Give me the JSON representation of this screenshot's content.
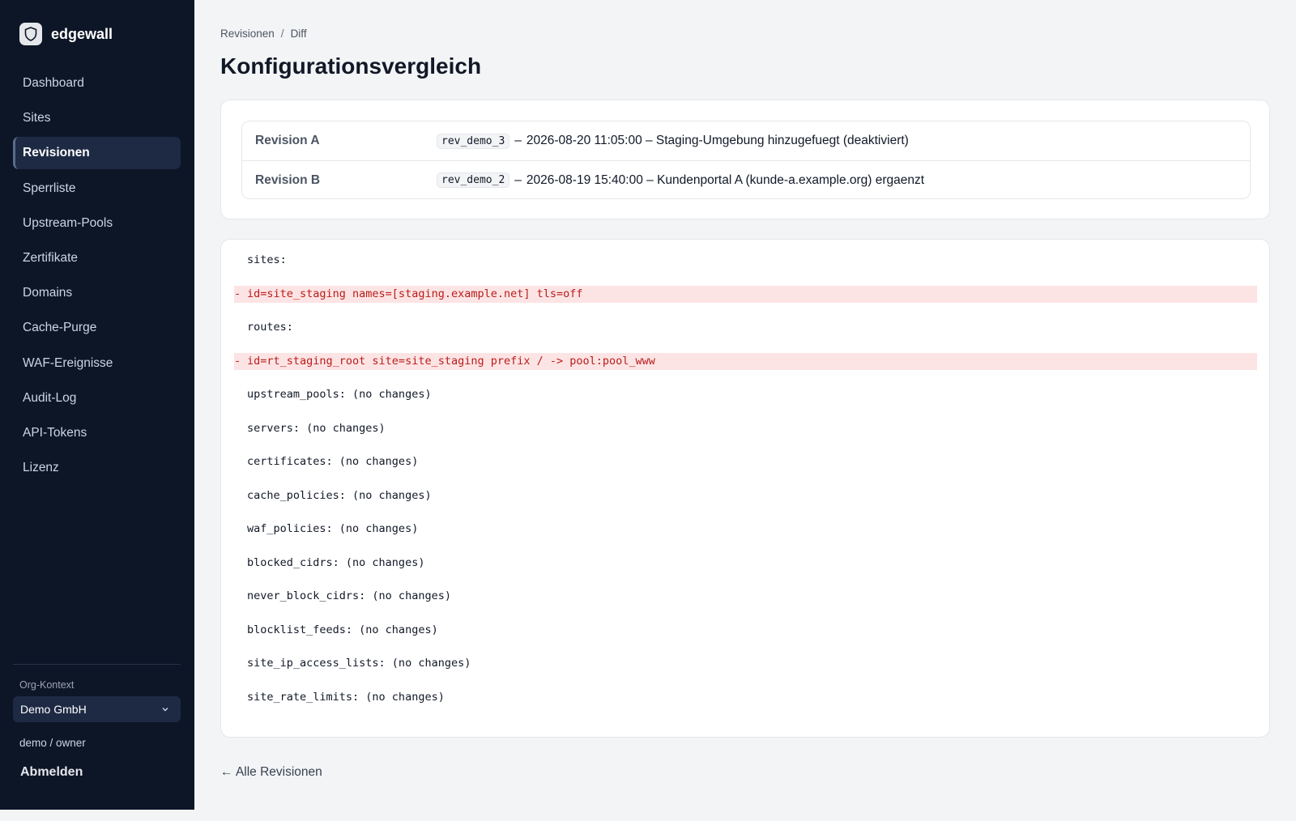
{
  "app": {
    "name": "edgewall",
    "logo_icon": "shield-icon"
  },
  "sidebar": {
    "items": [
      {
        "label": "Dashboard",
        "active": false
      },
      {
        "label": "Sites",
        "active": false
      },
      {
        "label": "Revisionen",
        "active": true
      },
      {
        "label": "Sperrliste",
        "active": false
      },
      {
        "label": "Upstream-Pools",
        "active": false
      },
      {
        "label": "Zertifikate",
        "active": false
      },
      {
        "label": "Domains",
        "active": false
      },
      {
        "label": "Cache-Purge",
        "active": false
      },
      {
        "label": "WAF-Ereignisse",
        "active": false
      },
      {
        "label": "Audit-Log",
        "active": false
      },
      {
        "label": "API-Tokens",
        "active": false
      },
      {
        "label": "Lizenz",
        "active": false
      }
    ],
    "org_label": "Org-Kontext",
    "org_selected": "Demo GmbH",
    "user": "demo / owner",
    "logout": "Abmelden"
  },
  "breadcrumb": {
    "parent": "Revisionen",
    "current": "Diff"
  },
  "page_title": "Konfigurationsvergleich",
  "revisions": [
    {
      "label": "Revision A",
      "id": "rev_demo_3",
      "separator": "–",
      "description": "2026-08-20 11:05:00 – Staging-Umgebung hinzugefuegt (deaktiviert)"
    },
    {
      "label": "Revision B",
      "id": "rev_demo_2",
      "separator": "–",
      "description": "2026-08-19 15:40:00 – Kundenportal A (kunde-a.example.org) ergaenzt"
    }
  ],
  "diff": [
    {
      "type": "context",
      "marker": "",
      "text": "sites:"
    },
    {
      "type": "removed",
      "marker": "-",
      "text": "id=site_staging names=[staging.example.net] tls=off"
    },
    {
      "type": "context",
      "marker": "",
      "text": "routes:"
    },
    {
      "type": "removed",
      "marker": "-",
      "text": "id=rt_staging_root site=site_staging prefix / -> pool:pool_www"
    },
    {
      "type": "context",
      "marker": "",
      "text": "upstream_pools: (no changes)"
    },
    {
      "type": "context",
      "marker": "",
      "text": "servers: (no changes)"
    },
    {
      "type": "context",
      "marker": "",
      "text": "certificates: (no changes)"
    },
    {
      "type": "context",
      "marker": "",
      "text": "cache_policies: (no changes)"
    },
    {
      "type": "context",
      "marker": "",
      "text": "waf_policies: (no changes)"
    },
    {
      "type": "context",
      "marker": "",
      "text": "blocked_cidrs: (no changes)"
    },
    {
      "type": "context",
      "marker": "",
      "text": "never_block_cidrs: (no changes)"
    },
    {
      "type": "context",
      "marker": "",
      "text": "blocklist_feeds: (no changes)"
    },
    {
      "type": "context",
      "marker": "",
      "text": "site_ip_access_lists: (no changes)"
    },
    {
      "type": "context",
      "marker": "",
      "text": "site_rate_limits: (no changes)"
    }
  ],
  "back_link": "← Alle Revisionen",
  "colors": {
    "sidebar_bg": "#0d1627",
    "removed_bg": "#fde4e4",
    "removed_text": "#b91c1c"
  }
}
